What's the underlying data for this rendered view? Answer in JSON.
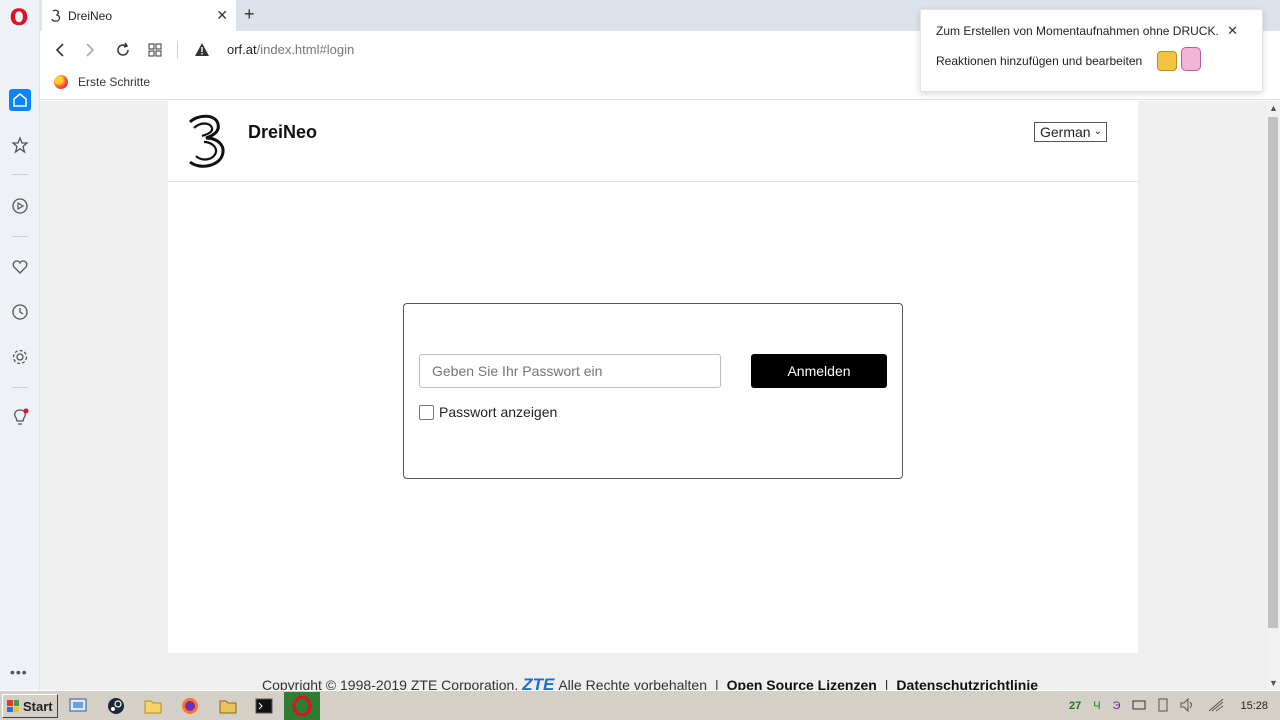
{
  "browser": {
    "tab": {
      "title": "DreiNeo"
    },
    "address": {
      "host": "orf.at",
      "path": "/index.html#login"
    },
    "bookmarks": [
      {
        "label": "Erste Schritte"
      }
    ]
  },
  "notification": {
    "line1": "Zum Erstellen von Momentaufnahmen ohne DRUCK.",
    "line2": "Reaktionen hinzufügen und bearbeiten"
  },
  "page": {
    "brand": "DreiNeo",
    "language": {
      "selected": "German"
    },
    "login": {
      "password_placeholder": "Geben Sie Ihr Passwort ein",
      "submit_label": "Anmelden",
      "show_password_label": "Passwort anzeigen"
    },
    "footer": {
      "copyright": "Copyright © 1998-2019 ZTE Corporation.",
      "zte": "ZTE",
      "rights": "Alle Rechte vorbehalten",
      "separator": "|",
      "link_open_source": "Open Source Lizenzen",
      "link_privacy": "Datenschutzrichtlinie"
    }
  },
  "taskbar": {
    "start_label": "Start",
    "tray": {
      "indicator_1": "27",
      "indicator_2": "Ч",
      "indicator_3": "Э"
    },
    "clock": "15:28"
  },
  "colors": {
    "opera_red": "#e0102a",
    "accent_blue": "#0a84ff",
    "zte_blue": "#1a6fc9",
    "active_task_green": "#2e7d32"
  }
}
